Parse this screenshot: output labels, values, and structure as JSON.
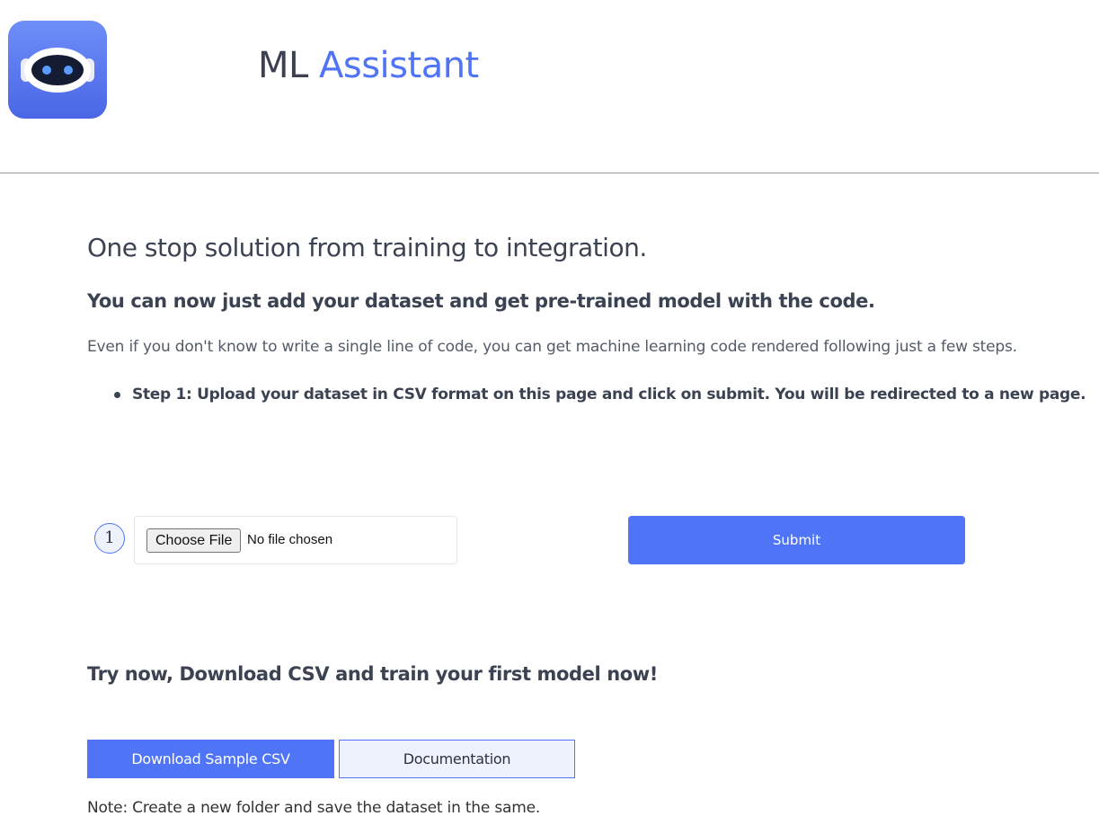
{
  "header": {
    "title_part1": "ML",
    "title_part2": "Assistant",
    "accent_color": "#4f74f5",
    "logo_icon": "robot-icon"
  },
  "hero": {
    "heading": "One stop solution from training to integration.",
    "subheading": "You can now just add your dataset and get pre-trained model with the code.",
    "description": "Even if you don't know to write a single line of code, you can get machine learning code rendered following just a few steps.",
    "steps": [
      "Step 1: Upload your dataset in CSV format on this page and click on submit. You will be redirected to a new page."
    ]
  },
  "upload": {
    "step_number": "1",
    "choose_file_label": "Choose File",
    "file_status": "No file chosen",
    "submit_label": "Submit"
  },
  "try_section": {
    "heading": "Try now, Download CSV and train your first model now!",
    "download_label": "Download Sample CSV",
    "docs_label": "Documentation",
    "note": "Note: Create a new folder and save the dataset in the same."
  }
}
